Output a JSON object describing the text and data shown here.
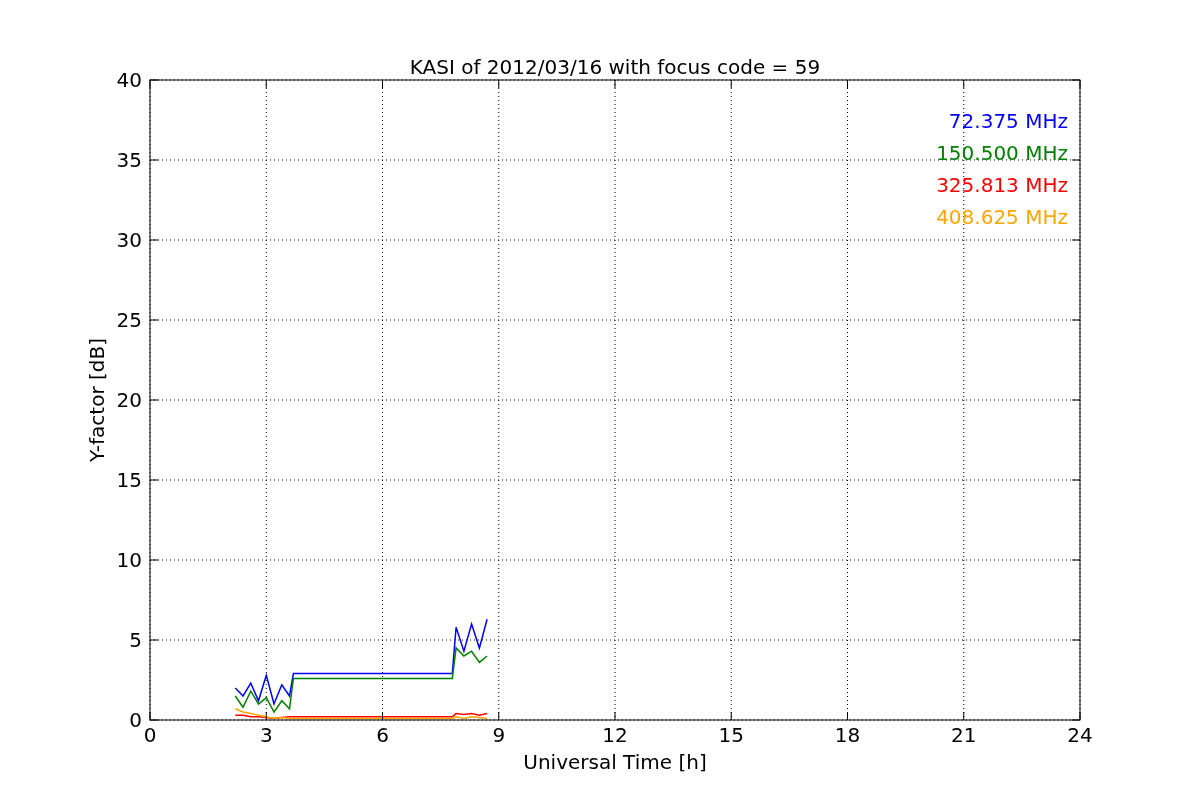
{
  "chart_data": {
    "type": "line",
    "title": "KASI of 2012/03/16 with focus code = 59",
    "xlabel": "Universal Time [h]",
    "ylabel": "Y-factor [dB]",
    "x": [
      2.2,
      2.4,
      2.6,
      2.8,
      3.0,
      3.2,
      3.4,
      3.6,
      3.7,
      7.8,
      7.9,
      8.1,
      8.3,
      8.5,
      8.7
    ],
    "series": [
      {
        "name": "72.375 MHz",
        "color": "#0000ff",
        "values": [
          2.0,
          1.5,
          2.3,
          1.2,
          2.8,
          1.0,
          2.2,
          1.5,
          2.9,
          2.9,
          5.8,
          4.3,
          6.0,
          4.5,
          6.3
        ]
      },
      {
        "name": "150.500 MHz",
        "color": "#008000",
        "values": [
          1.5,
          0.8,
          1.8,
          1.0,
          1.4,
          0.5,
          1.2,
          0.7,
          2.6,
          2.6,
          4.5,
          4.0,
          4.3,
          3.6,
          4.0
        ]
      },
      {
        "name": "325.813 MHz",
        "color": "#ff0000",
        "values": [
          0.3,
          0.3,
          0.2,
          0.2,
          0.15,
          0.1,
          0.15,
          0.2,
          0.2,
          0.2,
          0.4,
          0.35,
          0.4,
          0.3,
          0.4
        ]
      },
      {
        "name": "408.625 MHz",
        "color": "#ffa500",
        "values": [
          0.7,
          0.5,
          0.4,
          0.3,
          0.2,
          0.1,
          0.15,
          0.1,
          0.1,
          0.1,
          0.2,
          0.1,
          0.2,
          0.15,
          0.1
        ]
      }
    ],
    "grid": true,
    "xlim": [
      0,
      24
    ],
    "ylim": [
      0,
      40
    ],
    "xticks": [
      0,
      3,
      6,
      9,
      12,
      15,
      18,
      21,
      24
    ],
    "yticks": [
      0,
      5,
      10,
      15,
      20,
      25,
      30,
      35,
      40
    ]
  }
}
